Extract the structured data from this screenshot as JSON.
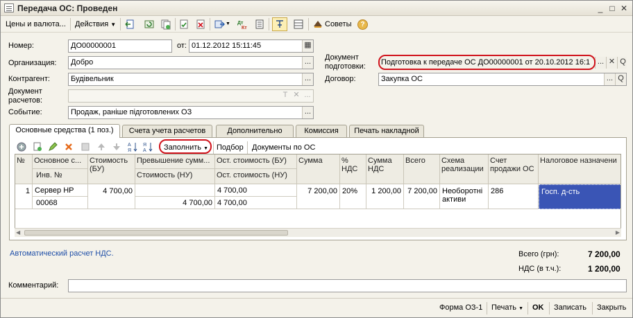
{
  "window": {
    "title": "Передача ОС: Проведен",
    "minimize": "_",
    "maximize": "□",
    "close": "✕"
  },
  "toolbar": {
    "prices_label": "Цены и валюта...",
    "actions_label": "Действия",
    "advice_label": "Советы",
    "help_label": "?"
  },
  "form": {
    "number_label": "Номер:",
    "number_value": "ДО00000001",
    "from_label": "от:",
    "date_value": "01.12.2012 15:11:45",
    "org_label": "Организация:",
    "org_value": "Добро",
    "contr_label": "Контрагент:",
    "contr_value": "Будівельник",
    "docpay_label_1": "Документ",
    "docpay_label_2": "расчетов:",
    "docpay_value": "",
    "event_label": "Событие:",
    "event_value": "Продаж, раніше підготовлених ОЗ",
    "prepdoc_label_1": "Документ",
    "prepdoc_label_2": "подготовки:",
    "prepdoc_value": "Подготовка к передаче ОС ДО00000001 от 20.10.2012 16:1",
    "contract_label": "Договор:",
    "contract_value": "Закупка ОС",
    "ellipsis": "...",
    "clear": "✕",
    "search": "Q",
    "t_icon": "T"
  },
  "tabs": [
    {
      "label": "Основные средства (1 поз.)"
    },
    {
      "label": "Счета учета расчетов"
    },
    {
      "label": "Дополнительно"
    },
    {
      "label": "Комиссия"
    },
    {
      "label": "Печать накладной"
    }
  ],
  "table_toolbar": {
    "fill_label": "Заполнить",
    "select_label": "Подбор",
    "docs_label": "Документы по ОС"
  },
  "table": {
    "headers": {
      "num": "№",
      "os": "Основное с...",
      "inv": "Инв. №",
      "cost_bu": "Стоимость (БУ)",
      "excess": "Превышение сумм...",
      "cost_nu": "Стоимость (НУ)",
      "rest_bu": "Ост. стоимость (БУ)",
      "rest_nu": "Ост. стоимость (НУ)",
      "sum": "Сумма",
      "vat_pct": "% НДС",
      "vat_sum": "Сумма НДС",
      "total": "Всего",
      "scheme": "Схема реализации",
      "account": "Счет продажи ОС",
      "tax": "Налоговое назначени"
    },
    "rows": [
      {
        "num": "1",
        "os": "Сервер HP",
        "inv": "00068",
        "cost_bu": "4 700,00",
        "excess": "",
        "cost_nu": "4 700,00",
        "rest_bu": "4 700,00",
        "rest_nu": "4 700,00",
        "sum": "7 200,00",
        "vat_pct": "20%",
        "vat_sum": "1 200,00",
        "total": "7 200,00",
        "scheme": "Необоротні активи",
        "account": "286",
        "tax": "Госп. д-сть"
      }
    ]
  },
  "summary": {
    "auto_vat_link": "Автоматический расчет НДС.",
    "total_label": "Всего (грн):",
    "total_value": "7 200,00",
    "vat_label": "НДС (в т.ч.):",
    "vat_value": "1 200,00"
  },
  "comment": {
    "label": "Комментарий:",
    "value": ""
  },
  "footer": {
    "form_label": "Форма ОЗ-1",
    "print_label": "Печать",
    "ok_label": "OK",
    "save_label": "Записать",
    "close_label": "Закрыть"
  },
  "colors": {
    "selection": "#3a55b5",
    "highlight_oval": "#d0121b",
    "link": "#1f4fa8"
  }
}
